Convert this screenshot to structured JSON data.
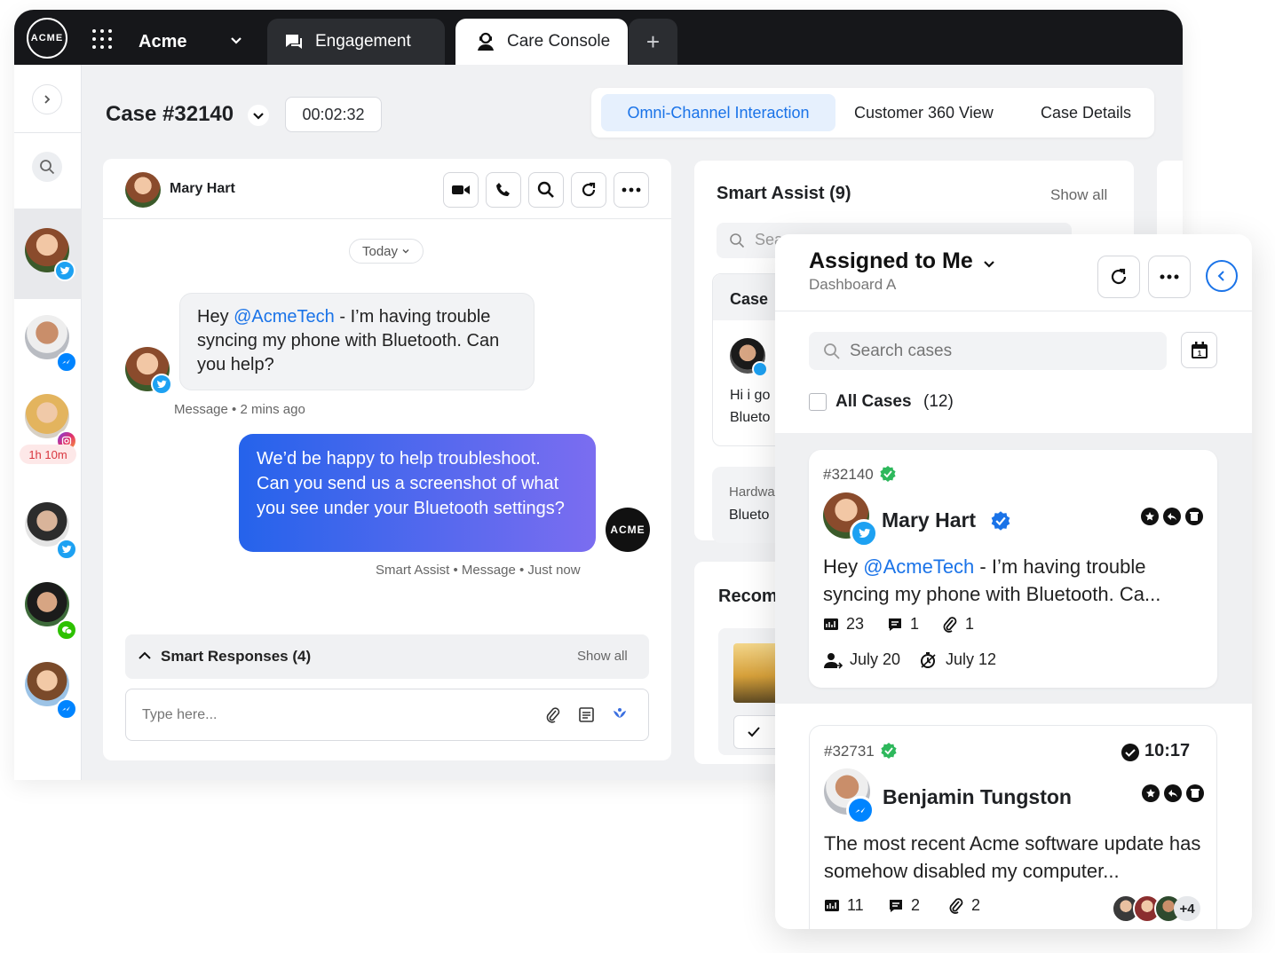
{
  "topbar": {
    "logo_text": "ACME",
    "workspace": "Acme",
    "tabs": [
      {
        "label": "Engagement",
        "icon": "chat-icon"
      },
      {
        "label": "Care Console",
        "icon": "agent-icon",
        "active": true
      }
    ],
    "add_tab_label": "+"
  },
  "rail": {
    "timer_badge": "1h 10m",
    "contacts": [
      {
        "channel": "twitter"
      },
      {
        "channel": "messenger"
      },
      {
        "channel": "instagram"
      },
      {
        "channel": "twitter"
      },
      {
        "channel": "wechat"
      },
      {
        "channel": "messenger"
      }
    ]
  },
  "case_header": {
    "title": "Case #32140",
    "timer": "00:02:32",
    "views": [
      "Omni-Channel Interaction",
      "Customer 360 View",
      "Case Details"
    ]
  },
  "chat": {
    "contact_name": "Mary Hart",
    "date_divider": "Today",
    "incoming": {
      "prefix": "Hey ",
      "mention": "@AcmeTech",
      "rest": " - I’m having trouble syncing my phone with Bluetooth. Can you help?",
      "meta": "Message • 2 mins ago"
    },
    "outgoing": {
      "text": "We’d be happy to help troubleshoot. Can you send us a screenshot of what you see under your Bluetooth settings?",
      "meta": "Smart Assist • Message • Just now",
      "avatar_text": "ACME"
    },
    "smart_responses": {
      "label": "Smart Responses (4)",
      "show_all": "Show all"
    },
    "composer_placeholder": "Type here..."
  },
  "smart_assist": {
    "title": "Smart Assist (9)",
    "show_all": "Show all",
    "search_partial": "Sea",
    "case_label_partial": "Case",
    "msg_line1": "Hi i go",
    "msg_line2": "Blueto",
    "tag_label": "Hardwa",
    "tag_value": "Blueto",
    "recom_partial": "Recom"
  },
  "assigned": {
    "title": "Assigned to Me",
    "subtitle": "Dashboard A",
    "search_placeholder": "Search cases",
    "all_cases_label": "All Cases",
    "all_cases_count": "(12)",
    "cases": [
      {
        "id": "#32140",
        "name": "Mary Hart",
        "channel": "twitter",
        "verified": true,
        "msg_prefix": "Hey ",
        "msg_mention": "@AcmeTech",
        "msg_rest": " - I’m having trouble syncing my phone with Bluetooth. Ca...",
        "messages": "23",
        "notes": "1",
        "attachments": "1",
        "assigned_date": "July 20",
        "due_date": "July 12"
      },
      {
        "id": "#32731",
        "time": "10:17",
        "name": "Benjamin Tungston",
        "channel": "messenger",
        "message": "The most recent Acme software update has somehow disabled my computer...",
        "messages": "11",
        "notes": "2",
        "attachments": "2",
        "more_agents": "+4"
      }
    ]
  },
  "colors": {
    "accent": "#1a73e8",
    "topbar": "#16171a",
    "status_green": "#2eb85c",
    "alert_red": "#d9363e"
  }
}
